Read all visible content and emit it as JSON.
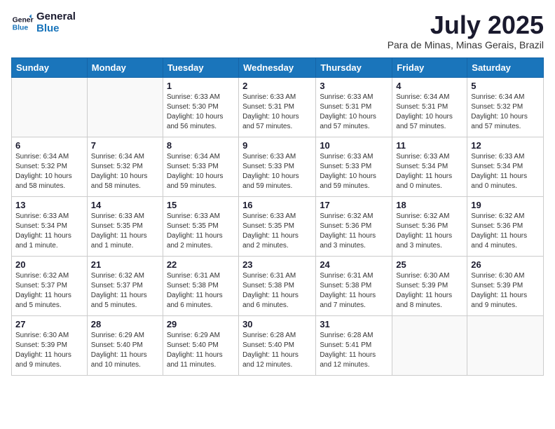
{
  "header": {
    "logo_line1": "General",
    "logo_line2": "Blue",
    "month_year": "July 2025",
    "location": "Para de Minas, Minas Gerais, Brazil"
  },
  "weekdays": [
    "Sunday",
    "Monday",
    "Tuesday",
    "Wednesday",
    "Thursday",
    "Friday",
    "Saturday"
  ],
  "weeks": [
    [
      {
        "day": "",
        "info": ""
      },
      {
        "day": "",
        "info": ""
      },
      {
        "day": "1",
        "info": "Sunrise: 6:33 AM\nSunset: 5:30 PM\nDaylight: 10 hours and 56 minutes."
      },
      {
        "day": "2",
        "info": "Sunrise: 6:33 AM\nSunset: 5:31 PM\nDaylight: 10 hours and 57 minutes."
      },
      {
        "day": "3",
        "info": "Sunrise: 6:33 AM\nSunset: 5:31 PM\nDaylight: 10 hours and 57 minutes."
      },
      {
        "day": "4",
        "info": "Sunrise: 6:34 AM\nSunset: 5:31 PM\nDaylight: 10 hours and 57 minutes."
      },
      {
        "day": "5",
        "info": "Sunrise: 6:34 AM\nSunset: 5:32 PM\nDaylight: 10 hours and 57 minutes."
      }
    ],
    [
      {
        "day": "6",
        "info": "Sunrise: 6:34 AM\nSunset: 5:32 PM\nDaylight: 10 hours and 58 minutes."
      },
      {
        "day": "7",
        "info": "Sunrise: 6:34 AM\nSunset: 5:32 PM\nDaylight: 10 hours and 58 minutes."
      },
      {
        "day": "8",
        "info": "Sunrise: 6:34 AM\nSunset: 5:33 PM\nDaylight: 10 hours and 59 minutes."
      },
      {
        "day": "9",
        "info": "Sunrise: 6:33 AM\nSunset: 5:33 PM\nDaylight: 10 hours and 59 minutes."
      },
      {
        "day": "10",
        "info": "Sunrise: 6:33 AM\nSunset: 5:33 PM\nDaylight: 10 hours and 59 minutes."
      },
      {
        "day": "11",
        "info": "Sunrise: 6:33 AM\nSunset: 5:34 PM\nDaylight: 11 hours and 0 minutes."
      },
      {
        "day": "12",
        "info": "Sunrise: 6:33 AM\nSunset: 5:34 PM\nDaylight: 11 hours and 0 minutes."
      }
    ],
    [
      {
        "day": "13",
        "info": "Sunrise: 6:33 AM\nSunset: 5:34 PM\nDaylight: 11 hours and 1 minute."
      },
      {
        "day": "14",
        "info": "Sunrise: 6:33 AM\nSunset: 5:35 PM\nDaylight: 11 hours and 1 minute."
      },
      {
        "day": "15",
        "info": "Sunrise: 6:33 AM\nSunset: 5:35 PM\nDaylight: 11 hours and 2 minutes."
      },
      {
        "day": "16",
        "info": "Sunrise: 6:33 AM\nSunset: 5:35 PM\nDaylight: 11 hours and 2 minutes."
      },
      {
        "day": "17",
        "info": "Sunrise: 6:32 AM\nSunset: 5:36 PM\nDaylight: 11 hours and 3 minutes."
      },
      {
        "day": "18",
        "info": "Sunrise: 6:32 AM\nSunset: 5:36 PM\nDaylight: 11 hours and 3 minutes."
      },
      {
        "day": "19",
        "info": "Sunrise: 6:32 AM\nSunset: 5:36 PM\nDaylight: 11 hours and 4 minutes."
      }
    ],
    [
      {
        "day": "20",
        "info": "Sunrise: 6:32 AM\nSunset: 5:37 PM\nDaylight: 11 hours and 5 minutes."
      },
      {
        "day": "21",
        "info": "Sunrise: 6:32 AM\nSunset: 5:37 PM\nDaylight: 11 hours and 5 minutes."
      },
      {
        "day": "22",
        "info": "Sunrise: 6:31 AM\nSunset: 5:38 PM\nDaylight: 11 hours and 6 minutes."
      },
      {
        "day": "23",
        "info": "Sunrise: 6:31 AM\nSunset: 5:38 PM\nDaylight: 11 hours and 6 minutes."
      },
      {
        "day": "24",
        "info": "Sunrise: 6:31 AM\nSunset: 5:38 PM\nDaylight: 11 hours and 7 minutes."
      },
      {
        "day": "25",
        "info": "Sunrise: 6:30 AM\nSunset: 5:39 PM\nDaylight: 11 hours and 8 minutes."
      },
      {
        "day": "26",
        "info": "Sunrise: 6:30 AM\nSunset: 5:39 PM\nDaylight: 11 hours and 9 minutes."
      }
    ],
    [
      {
        "day": "27",
        "info": "Sunrise: 6:30 AM\nSunset: 5:39 PM\nDaylight: 11 hours and 9 minutes."
      },
      {
        "day": "28",
        "info": "Sunrise: 6:29 AM\nSunset: 5:40 PM\nDaylight: 11 hours and 10 minutes."
      },
      {
        "day": "29",
        "info": "Sunrise: 6:29 AM\nSunset: 5:40 PM\nDaylight: 11 hours and 11 minutes."
      },
      {
        "day": "30",
        "info": "Sunrise: 6:28 AM\nSunset: 5:40 PM\nDaylight: 11 hours and 12 minutes."
      },
      {
        "day": "31",
        "info": "Sunrise: 6:28 AM\nSunset: 5:41 PM\nDaylight: 11 hours and 12 minutes."
      },
      {
        "day": "",
        "info": ""
      },
      {
        "day": "",
        "info": ""
      }
    ]
  ]
}
